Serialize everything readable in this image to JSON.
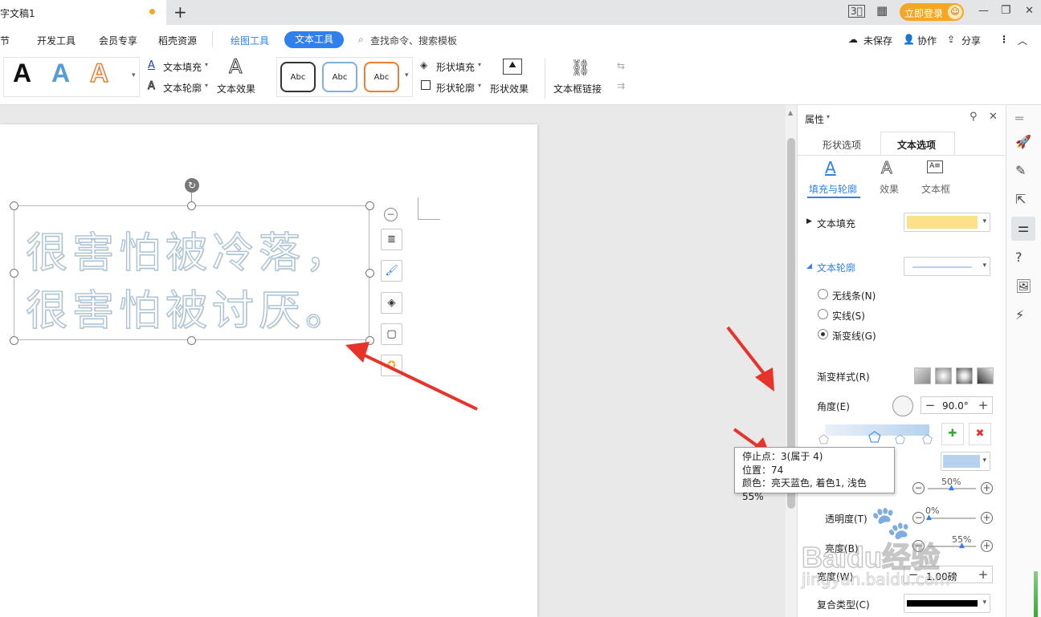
{
  "doc_tab": {
    "title": "字文稿1"
  },
  "window": {
    "new_tab": "+",
    "login": "立即登录",
    "avatar": "☺",
    "menu_icon": "3⃣",
    "grid_icon": "▦",
    "min": "—",
    "restore": "❐",
    "close": "✕"
  },
  "menu": {
    "items": [
      "章节",
      "开发工具",
      "会员专享",
      "稻壳资源"
    ],
    "draw_tool": "绘图工具",
    "text_tool": "文本工具",
    "search": "查找命令、搜索模板",
    "unsaved": "未保存",
    "collab": "协作",
    "share": "分享"
  },
  "ribbon": {
    "wordart_letter": "A",
    "text_fill": "文本填充",
    "text_outline": "文本轮廓",
    "text_effect": "文本效果",
    "abc_labels": [
      "Abc",
      "Abc",
      "Abc"
    ],
    "shape_fill": "形状填充",
    "shape_outline": "形状轮廓",
    "shape_effect": "形状效果",
    "text_frame_link": "文本框链接"
  },
  "document": {
    "lines": [
      "很害怕被冷落，",
      "很害怕被讨厌。"
    ]
  },
  "panel": {
    "title": "属性",
    "tabs": [
      "形状选项",
      "文本选项"
    ],
    "subtabs": [
      "填充与轮廓",
      "效果",
      "文本框"
    ],
    "text_fill": "文本填充",
    "text_outline": "文本轮廓",
    "radio_none": "无线条(N)",
    "radio_solid": "实线(S)",
    "radio_gradient": "渐变线(G)",
    "gradient_style": "渐变样式(R)",
    "angle": "角度(E)",
    "angle_value": "90.0°",
    "brightness_pct": "50%",
    "transparency": "透明度(T)",
    "transparency_pct": "0%",
    "luminance": "亮度(B)",
    "luminance_pct": "55%",
    "width": "宽度(W)",
    "width_value": "1.00磅",
    "compound": "复合类型(C)"
  },
  "tooltip": {
    "line1": "停止点：3(属于 4)",
    "line2": "位置：74",
    "line3": "颜色：亮天蓝色, 着色1, 浅色 55%"
  },
  "watermark": {
    "brand": "Baidu经验",
    "url": "jingyan.baidu.com"
  },
  "colors": {
    "accent": "#2f80ed",
    "orange": "#f5a623",
    "fill_swatch": "#fde08a",
    "stop_swatch": "#b7d2ee",
    "arrow": "#e8332b"
  }
}
